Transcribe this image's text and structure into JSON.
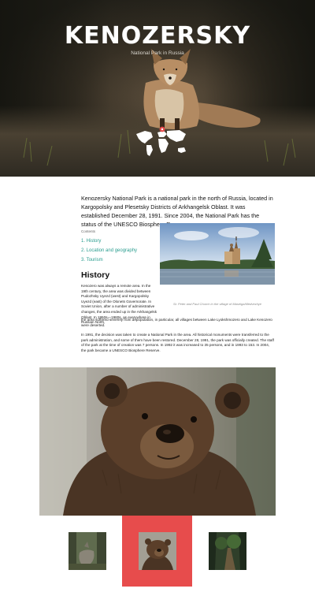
{
  "hero": {
    "title": "KENOZERSKY",
    "subtitle": "National Park in Russia"
  },
  "intro": "Kenozersky National Park is a national park in the north of Russia, located in Kargopolsky and Plesetsky Districts of Arkhangelsk Oblast. It was established December 28, 1991. Since 2004, the National Park has the status of the UNESCO Biosphere Reserve.",
  "toc": {
    "heading": "Contents",
    "items": [
      {
        "label": "1. History"
      },
      {
        "label": "2. Location and geography"
      },
      {
        "label": "3. Tourism"
      }
    ]
  },
  "photo": {
    "caption": "St. Peter and Paul Church in the village of Maselga/Medvezhye"
  },
  "history": {
    "title": "History",
    "p1": "Kenozero was always a remote area. In the 19th century, the area was divided between Pudozhsky Uyezd (west) and Kargopolsky Uyezd (east) of the Olonets Governorate. In Soviet Union, after a number of administrative changes, the area ended up in the Arkhangelsk Oblast. In 1950s—1980s, as everywhere in Russian North,",
    "p1b": "the area suffered severely from depopulation, in particular, all villages between Lake Lyokshmozero and Lake Kenozero were deserted.",
    "p2": "In 1991, the decision was taken to create a National Park in the area. All historical monuments were transferred to the park administration, and some of them have been restored. December 28, 1991, the park was officially created. The staff of the park at the time of creation was 7 persons. In 1992 it was increased to 35 persons, and in 1993 to 153. In 2004, the park became a UNESCO Biosphere Reserve."
  },
  "colors": {
    "accent": "#e74c4c",
    "link": "#2a9d8f"
  },
  "gallery": {
    "active_index": 1
  }
}
